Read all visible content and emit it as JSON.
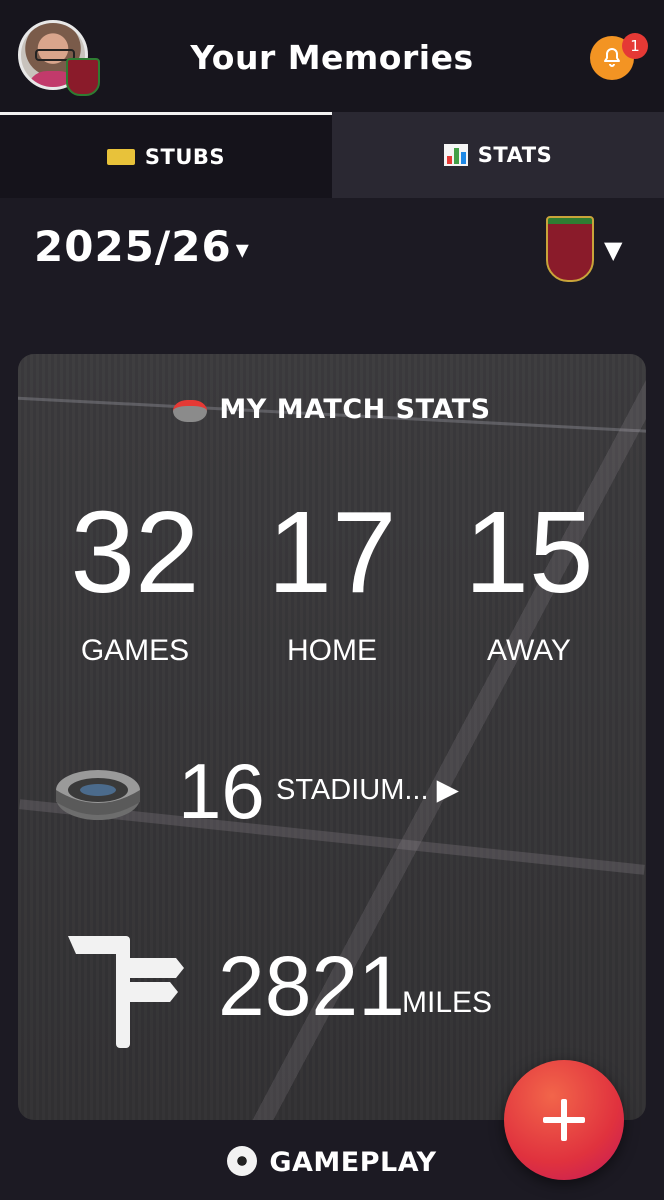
{
  "header": {
    "title": "Your Memories",
    "notification_count": "1"
  },
  "tabs": [
    {
      "label": "STUBS",
      "icon": "ticket-icon",
      "active": false
    },
    {
      "label": "STATS",
      "icon": "bar-chart-icon",
      "active": true
    }
  ],
  "season": {
    "value": "2025/26",
    "caret": "▾"
  },
  "club_selector": {
    "caret": "▼"
  },
  "stats_card": {
    "title": "MY MATCH STATS",
    "totals": [
      {
        "value": "32",
        "label": "GAMES"
      },
      {
        "value": "17",
        "label": "HOME"
      },
      {
        "value": "15",
        "label": "AWAY"
      }
    ],
    "stadiums": {
      "value": "16",
      "label": "STADIUM... ▶"
    },
    "distance": {
      "value": "2821",
      "label": "MILES"
    }
  },
  "section": {
    "label": "GAMEPLAY"
  },
  "fab": {
    "icon": "plus-icon"
  },
  "colors": {
    "background": "#1c1a23",
    "bell": "#f39423",
    "badge": "#e53935",
    "fab": "#e0323e"
  }
}
